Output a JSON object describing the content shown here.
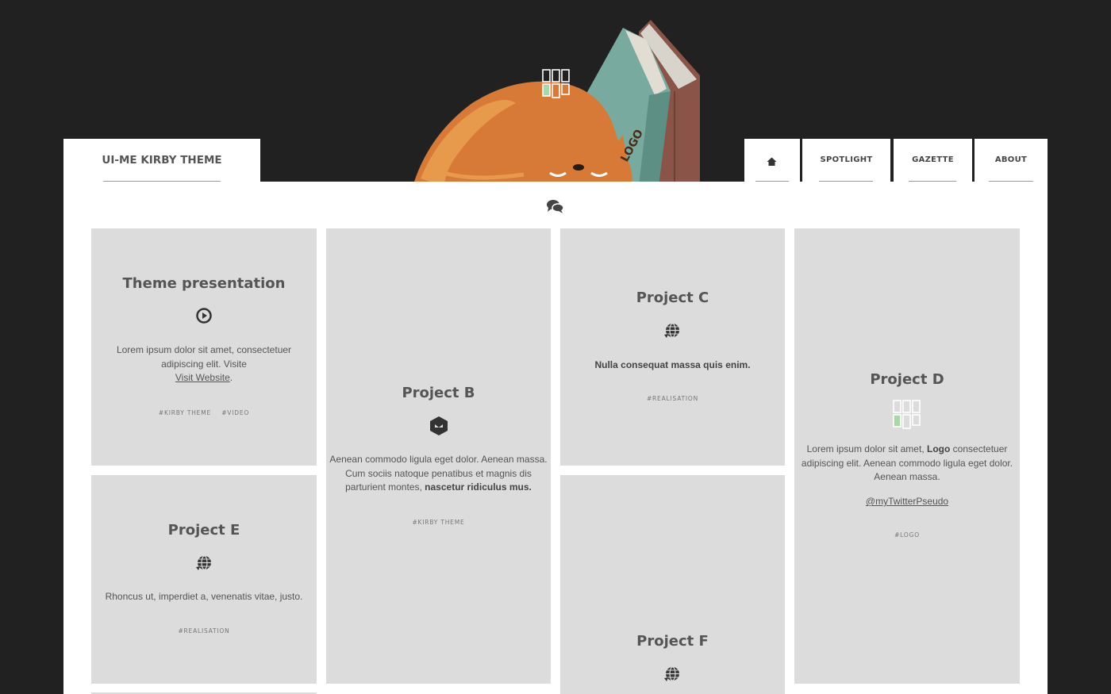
{
  "brand": {
    "label": "UI-ME KIRBY THEME"
  },
  "nav": {
    "home_icon": "home-icon",
    "items": [
      {
        "label": "SPOTLIGHT"
      },
      {
        "label": "GAZETTE"
      },
      {
        "label": "ABOUT"
      }
    ]
  },
  "header_icons": {
    "logo": "logo-grid-icon",
    "comments": "comments-icon"
  },
  "cards": {
    "theme": {
      "title": "Theme presentation",
      "icon": "video-play-icon",
      "text_line1": "Lorem ipsum dolor sit amet, consectetuer",
      "text_line2": "adipiscing elit. Visite",
      "link": "Visit Website",
      "tags": [
        "#KIRBY THEME",
        "#VIDEO"
      ]
    },
    "b": {
      "title": "Project B",
      "icon": "hexagon-icon",
      "text_line1": "Aenean commodo ligula eget dolor. Aenean massa.",
      "text_line2": "Cum sociis natoque penatibus et magnis dis",
      "text_line3_plain": "parturient montes,",
      "text_line3_bold": "nascetur ridiculus mus.",
      "tags": [
        "#KIRBY THEME"
      ]
    },
    "c": {
      "title": "Project C",
      "icon": "globe-icon",
      "strong": "Nulla consequat massa quis enim.",
      "tags": [
        "#REALISATION"
      ]
    },
    "d": {
      "title": "Project D",
      "icon": "logo-grid-icon",
      "text_line1_plain_a": "Lorem ipsum dolor sit amet,",
      "text_line1_bold": "Logo",
      "text_line1_plain_b": "consectetuer",
      "text_line2": "adipiscing elit. Aenean commodo ligula eget dolor.",
      "text_line3": "Aenean massa.",
      "link": "@myTwitterPseudo",
      "tags": [
        "#LOGO"
      ]
    },
    "e": {
      "title": "Project E",
      "icon": "globe-icon",
      "text": "Rhoncus ut, imperdiet a, venenatis vitae, justo.",
      "tags": [
        "#REALISATION"
      ]
    },
    "f": {
      "title": "Project F",
      "icon": "globe-icon"
    }
  },
  "colors": {
    "background": "#212121",
    "card": "#dcdcdc",
    "cat_orange": "#d77a38",
    "book_teal": "#79aaa0",
    "book_brown": "#8a5448",
    "logo_green": "#a8d8a8"
  }
}
